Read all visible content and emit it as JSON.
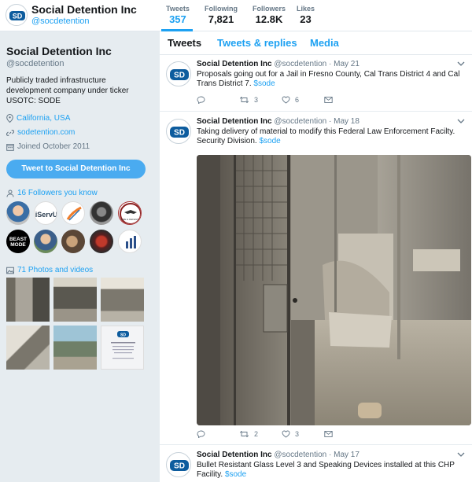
{
  "profile": {
    "name": "Social Detention Inc",
    "handle": "@socdetention",
    "bio": "Publicly traded infrastructure development company under ticker USOTC: SODE",
    "location": "California, USA",
    "website": "sodetention.com",
    "joined": "Joined October 2011",
    "tweet_to_label": "Tweet to Social Detention Inc",
    "followers_you_know": "16 Followers you know",
    "photos_videos": "71 Photos and videos",
    "logo_text": "SD"
  },
  "stats": [
    {
      "label": "Tweets",
      "value": "357",
      "active": true
    },
    {
      "label": "Following",
      "value": "7,821"
    },
    {
      "label": "Followers",
      "value": "12.8K"
    },
    {
      "label": "Likes",
      "value": "23"
    }
  ],
  "tabs": [
    {
      "label": "Tweets",
      "active": true
    },
    {
      "label": "Tweets & replies"
    },
    {
      "label": "Media"
    }
  ],
  "followers_badges": [
    "BEAST MODE",
    "iServU",
    "SIZE & DEFENSE"
  ],
  "tweets": [
    {
      "name": "Social Detention Inc",
      "handle": "@socdetention",
      "date": "May 21",
      "text": "Proposals going out for a Jail in Fresno County,  Cal Trans District 4 and Cal Trans District 7.",
      "cashtag": "$sode",
      "retweets": "3",
      "likes": "6"
    },
    {
      "name": "Social Detention Inc",
      "handle": "@socdetention",
      "date": "May 18",
      "text": "Taking delivery of material to modify this Federal Law Enforcement Facilty. Security Division.",
      "cashtag": "$sode",
      "retweets": "2",
      "likes": "3"
    },
    {
      "name": "Social Detention Inc",
      "handle": "@socdetention",
      "date": "May 17",
      "text": "Bullet Resistant Glass Level 3 and Speaking Devices installed at this CHP Facility.",
      "cashtag": "$sode"
    }
  ],
  "colors": {
    "accent": "#1da1f2",
    "button": "#4aabf0",
    "background": "#e6ecf0",
    "logo": "#0d5c9e"
  }
}
